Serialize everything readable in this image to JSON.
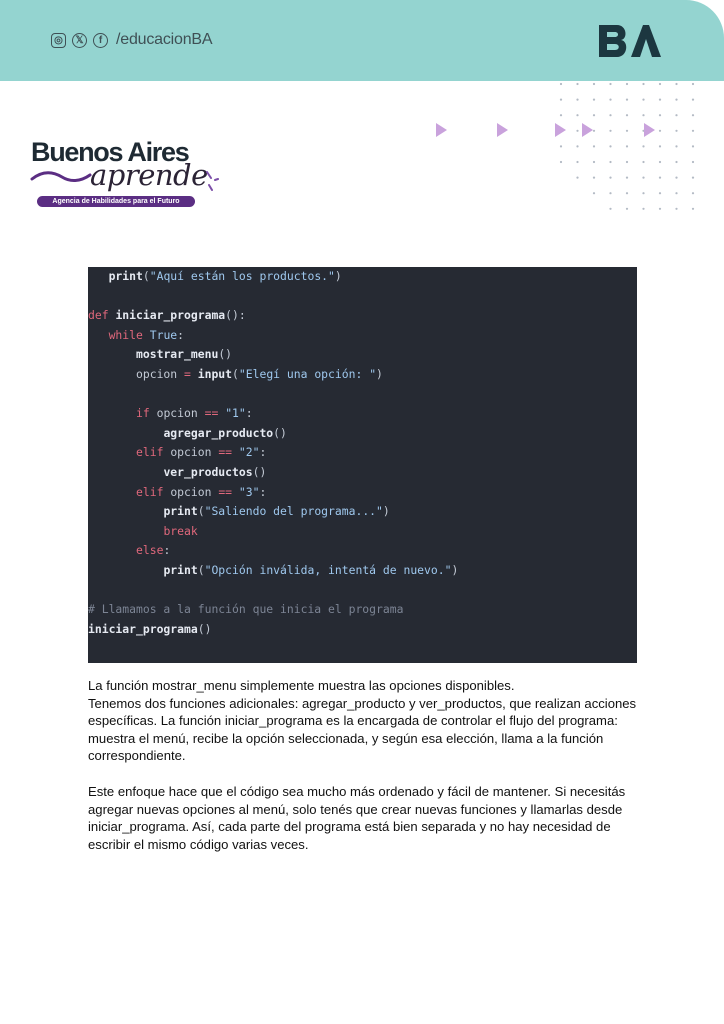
{
  "header": {
    "social_handle": "/educacionBA",
    "icons": [
      "instagram-icon",
      "x-icon",
      "facebook-icon"
    ],
    "logo_text": "BA",
    "bg_color": "#94d4d0"
  },
  "brand": {
    "title": "Buenos Aires",
    "script": "aprende",
    "tagline": "Agencia de Habilidades para el Futuro",
    "accent_color": "#5b2e83"
  },
  "code_block": {
    "lines": [
      [
        {
          "t": "   ",
          "c": "p"
        },
        {
          "t": "print",
          "c": "fn"
        },
        {
          "t": "(",
          "c": "p"
        },
        {
          "t": "\"Aquí están los productos.\"",
          "c": "str"
        },
        {
          "t": ")",
          "c": "p"
        }
      ],
      [],
      [
        {
          "t": "def ",
          "c": "kw"
        },
        {
          "t": "iniciar_programa",
          "c": "fn"
        },
        {
          "t": "():",
          "c": "p"
        }
      ],
      [
        {
          "t": "   ",
          "c": "p"
        },
        {
          "t": "while ",
          "c": "kw"
        },
        {
          "t": "True",
          "c": "str"
        },
        {
          "t": ":",
          "c": "p"
        }
      ],
      [
        {
          "t": "       ",
          "c": "p"
        },
        {
          "t": "mostrar_menu",
          "c": "fn"
        },
        {
          "t": "()",
          "c": "p"
        }
      ],
      [
        {
          "t": "       opcion ",
          "c": "p"
        },
        {
          "t": "=",
          "c": "op"
        },
        {
          "t": " ",
          "c": "p"
        },
        {
          "t": "input",
          "c": "fn"
        },
        {
          "t": "(",
          "c": "p"
        },
        {
          "t": "\"Elegí una opción: \"",
          "c": "str"
        },
        {
          "t": ")",
          "c": "p"
        }
      ],
      [],
      [
        {
          "t": "       ",
          "c": "p"
        },
        {
          "t": "if ",
          "c": "kw"
        },
        {
          "t": "opcion ",
          "c": "p"
        },
        {
          "t": "==",
          "c": "op"
        },
        {
          "t": " ",
          "c": "p"
        },
        {
          "t": "\"1\"",
          "c": "str"
        },
        {
          "t": ":",
          "c": "p"
        }
      ],
      [
        {
          "t": "           ",
          "c": "p"
        },
        {
          "t": "agregar_producto",
          "c": "fn"
        },
        {
          "t": "()",
          "c": "p"
        }
      ],
      [
        {
          "t": "       ",
          "c": "p"
        },
        {
          "t": "elif ",
          "c": "kw"
        },
        {
          "t": "opcion ",
          "c": "p"
        },
        {
          "t": "==",
          "c": "op"
        },
        {
          "t": " ",
          "c": "p"
        },
        {
          "t": "\"2\"",
          "c": "str"
        },
        {
          "t": ":",
          "c": "p"
        }
      ],
      [
        {
          "t": "           ",
          "c": "p"
        },
        {
          "t": "ver_productos",
          "c": "fn"
        },
        {
          "t": "()",
          "c": "p"
        }
      ],
      [
        {
          "t": "       ",
          "c": "p"
        },
        {
          "t": "elif ",
          "c": "kw"
        },
        {
          "t": "opcion ",
          "c": "p"
        },
        {
          "t": "==",
          "c": "op"
        },
        {
          "t": " ",
          "c": "p"
        },
        {
          "t": "\"3\"",
          "c": "str"
        },
        {
          "t": ":",
          "c": "p"
        }
      ],
      [
        {
          "t": "           ",
          "c": "p"
        },
        {
          "t": "print",
          "c": "fn"
        },
        {
          "t": "(",
          "c": "p"
        },
        {
          "t": "\"Saliendo del programa...\"",
          "c": "str"
        },
        {
          "t": ")",
          "c": "p"
        }
      ],
      [
        {
          "t": "           ",
          "c": "p"
        },
        {
          "t": "break",
          "c": "kw"
        }
      ],
      [
        {
          "t": "       ",
          "c": "p"
        },
        {
          "t": "else",
          "c": "kw"
        },
        {
          "t": ":",
          "c": "p"
        }
      ],
      [
        {
          "t": "           ",
          "c": "p"
        },
        {
          "t": "print",
          "c": "fn"
        },
        {
          "t": "(",
          "c": "p"
        },
        {
          "t": "\"Opción inválida, intentá de nuevo.\"",
          "c": "str"
        },
        {
          "t": ")",
          "c": "p"
        }
      ],
      [],
      [
        {
          "t": "# Llamamos a la función que inicia el programa",
          "c": "com"
        }
      ],
      [
        {
          "t": "iniciar_programa",
          "c": "fn"
        },
        {
          "t": "()",
          "c": "p"
        }
      ]
    ]
  },
  "paragraphs": [
    "La función mostrar_menu simplemente muestra las opciones disponibles.",
    "Tenemos dos funciones adicionales: agregar_producto y ver_productos, que realizan acciones específicas. La función iniciar_programa es la encargada de controlar el flujo del programa: muestra el menú, recibe la opción seleccionada, y según esa elección, llama a la función correspondiente.",
    "Este enfoque hace que el código sea mucho más ordenado y fácil de mantener. Si necesitás agregar nuevas opciones al menú, solo tenés que crear nuevas funciones y llamarlas desde iniciar_programa. Así, cada parte del programa está bien separada y no hay necesidad de escribir el mismo código varias veces."
  ]
}
